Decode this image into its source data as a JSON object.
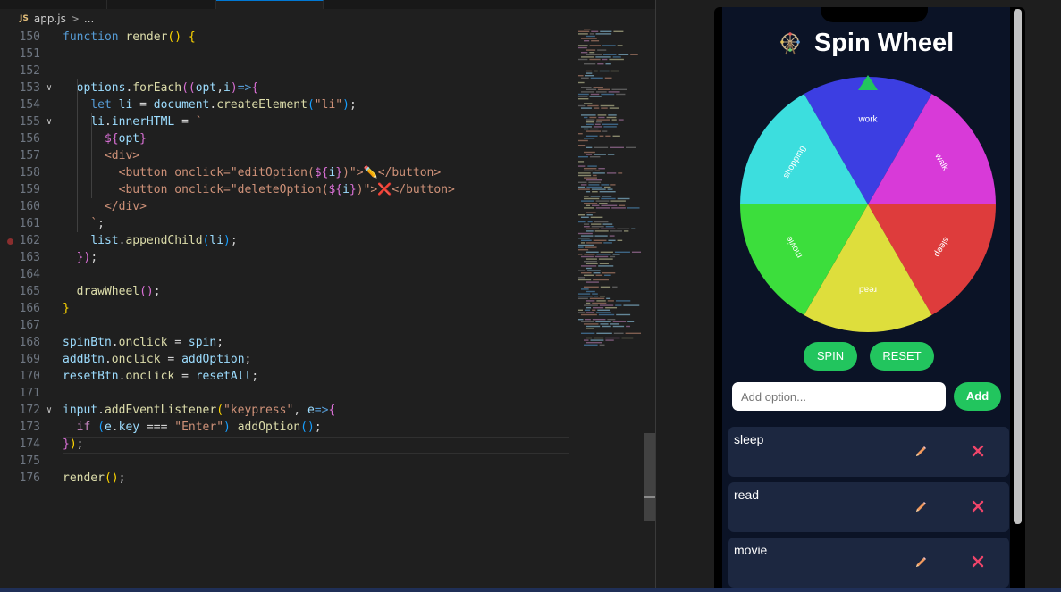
{
  "editor": {
    "file_name": "app.js",
    "file_type_badge": "JS",
    "breadcrumb_sep": ">",
    "breadcrumb_more": "...",
    "lines": [
      {
        "n": "150",
        "fold": false,
        "tokens": [
          [
            "kw",
            "function "
          ],
          [
            "fn",
            "render"
          ],
          [
            "pn",
            "() {"
          ]
        ]
      },
      {
        "n": "151",
        "fold": false,
        "tokens": []
      },
      {
        "n": "152",
        "fold": false,
        "tokens": []
      },
      {
        "n": "153",
        "fold": true,
        "tokens": [
          [
            "",
            "  "
          ],
          [
            "vr",
            "options"
          ],
          [
            "",
            "."
          ],
          [
            "fn",
            "forEach"
          ],
          [
            "pp",
            "(("
          ],
          [
            "vr",
            "opt"
          ],
          [
            "",
            ","
          ],
          [
            "vr",
            "i"
          ],
          [
            "pp",
            ")"
          ],
          [
            "kw",
            "=>"
          ],
          [
            "pp",
            "{"
          ]
        ]
      },
      {
        "n": "154",
        "fold": false,
        "tokens": [
          [
            "",
            "    "
          ],
          [
            "kw",
            "let "
          ],
          [
            "vr",
            "li"
          ],
          [
            "",
            " = "
          ],
          [
            "vr",
            "document"
          ],
          [
            "",
            "."
          ],
          [
            "fn",
            "createElement"
          ],
          [
            "pb",
            "("
          ],
          [
            "str",
            "\"li\""
          ],
          [
            "pb",
            ")"
          ],
          [
            "",
            ";"
          ]
        ]
      },
      {
        "n": "155",
        "fold": true,
        "tokens": [
          [
            "",
            "    "
          ],
          [
            "vr",
            "li"
          ],
          [
            "",
            "."
          ],
          [
            "vr",
            "innerHTML"
          ],
          [
            "",
            " = "
          ],
          [
            "tm",
            "`"
          ]
        ]
      },
      {
        "n": "156",
        "fold": false,
        "tokens": [
          [
            "",
            "      "
          ],
          [
            "pp",
            "${"
          ],
          [
            "vr",
            "opt"
          ],
          [
            "pp",
            "}"
          ]
        ]
      },
      {
        "n": "157",
        "fold": false,
        "tokens": [
          [
            "",
            "      "
          ],
          [
            "tm",
            "<div>"
          ]
        ]
      },
      {
        "n": "158",
        "fold": false,
        "tokens": [
          [
            "",
            "        "
          ],
          [
            "tm",
            "<button onclick=\"editOption("
          ],
          [
            "pp",
            "${"
          ],
          [
            "vr",
            "i"
          ],
          [
            "pp",
            "}"
          ],
          [
            "tm",
            ")\">✏️</button>"
          ]
        ]
      },
      {
        "n": "159",
        "fold": false,
        "tokens": [
          [
            "",
            "        "
          ],
          [
            "tm",
            "<button onclick=\"deleteOption("
          ],
          [
            "pp",
            "${"
          ],
          [
            "vr",
            "i"
          ],
          [
            "pp",
            "}"
          ],
          [
            "tm",
            ")\">❌</button>"
          ]
        ]
      },
      {
        "n": "160",
        "fold": false,
        "tokens": [
          [
            "",
            "      "
          ],
          [
            "tm",
            "</div>"
          ]
        ]
      },
      {
        "n": "161",
        "fold": false,
        "tokens": [
          [
            "",
            "    "
          ],
          [
            "tm",
            "`"
          ],
          [
            "",
            ";"
          ]
        ]
      },
      {
        "n": "162",
        "fold": false,
        "tokens": [
          [
            "",
            "    "
          ],
          [
            "vr",
            "list"
          ],
          [
            "",
            "."
          ],
          [
            "fn",
            "appendChild"
          ],
          [
            "pb",
            "("
          ],
          [
            "vr",
            "li"
          ],
          [
            "pb",
            ")"
          ],
          [
            "",
            ";"
          ]
        ]
      },
      {
        "n": "163",
        "fold": false,
        "tokens": [
          [
            "",
            "  "
          ],
          [
            "pp",
            "})"
          ],
          [
            "",
            ";"
          ]
        ]
      },
      {
        "n": "164",
        "fold": false,
        "tokens": []
      },
      {
        "n": "165",
        "fold": false,
        "tokens": [
          [
            "",
            "  "
          ],
          [
            "fn",
            "drawWheel"
          ],
          [
            "pp",
            "()"
          ],
          [
            "",
            ";"
          ]
        ]
      },
      {
        "n": "166",
        "fold": false,
        "tokens": [
          [
            "pn",
            "}"
          ]
        ]
      },
      {
        "n": "167",
        "fold": false,
        "tokens": []
      },
      {
        "n": "168",
        "fold": false,
        "tokens": [
          [
            "vr",
            "spinBtn"
          ],
          [
            "",
            "."
          ],
          [
            "fn",
            "onclick"
          ],
          [
            "",
            " = "
          ],
          [
            "vr",
            "spin"
          ],
          [
            "",
            ";"
          ]
        ]
      },
      {
        "n": "169",
        "fold": false,
        "tokens": [
          [
            "vr",
            "addBtn"
          ],
          [
            "",
            "."
          ],
          [
            "fn",
            "onclick"
          ],
          [
            "",
            " = "
          ],
          [
            "vr",
            "addOption"
          ],
          [
            "",
            ";"
          ]
        ]
      },
      {
        "n": "170",
        "fold": false,
        "tokens": [
          [
            "vr",
            "resetBtn"
          ],
          [
            "",
            "."
          ],
          [
            "fn",
            "onclick"
          ],
          [
            "",
            " = "
          ],
          [
            "vr",
            "resetAll"
          ],
          [
            "",
            ";"
          ]
        ]
      },
      {
        "n": "171",
        "fold": false,
        "tokens": []
      },
      {
        "n": "172",
        "fold": true,
        "tokens": [
          [
            "vr",
            "input"
          ],
          [
            "",
            "."
          ],
          [
            "fn",
            "addEventListener"
          ],
          [
            "pn",
            "("
          ],
          [
            "str",
            "\"keypress\""
          ],
          [
            "",
            ", "
          ],
          [
            "vr",
            "e"
          ],
          [
            "kw",
            "=>"
          ],
          [
            "pp",
            "{"
          ]
        ]
      },
      {
        "n": "173",
        "fold": false,
        "tokens": [
          [
            "",
            "  "
          ],
          [
            "ctl",
            "if "
          ],
          [
            "pb",
            "("
          ],
          [
            "vr",
            "e"
          ],
          [
            "",
            "."
          ],
          [
            "vr",
            "key"
          ],
          [
            "",
            " === "
          ],
          [
            "str",
            "\"Enter\""
          ],
          [
            "pb",
            ")"
          ],
          [
            "",
            " "
          ],
          [
            "fn",
            "addOption"
          ],
          [
            "pb",
            "()"
          ],
          [
            "",
            ";"
          ]
        ]
      },
      {
        "n": "174",
        "fold": false,
        "tokens": [
          [
            "pp",
            "}"
          ],
          [
            "pn",
            ")"
          ],
          [
            "",
            ";"
          ]
        ]
      },
      {
        "n": "175",
        "fold": false,
        "tokens": []
      },
      {
        "n": "176",
        "fold": false,
        "tokens": [
          [
            "fn",
            "render"
          ],
          [
            "pn",
            "()"
          ],
          [
            "",
            ";"
          ]
        ]
      }
    ]
  },
  "app": {
    "title": "Spin Wheel",
    "wheel_icon": "ferris-wheel-icon",
    "spin_label": "SPIN",
    "reset_label": "RESET",
    "input_placeholder": "Add option...",
    "add_label": "Add",
    "pointer_color": "#22c55e",
    "accent": "#22c55e",
    "background": "#0b1326",
    "segments": [
      {
        "label": "work",
        "color": "#3c3ee2"
      },
      {
        "label": "walk",
        "color": "#d83ad8"
      },
      {
        "label": "sleep",
        "color": "#de3c3c"
      },
      {
        "label": "read",
        "color": "#dede3c"
      },
      {
        "label": "movie",
        "color": "#3cde3c"
      },
      {
        "label": "shopping",
        "color": "#3cdede"
      }
    ],
    "options": [
      {
        "label": "sleep"
      },
      {
        "label": "read"
      },
      {
        "label": "movie"
      }
    ]
  }
}
